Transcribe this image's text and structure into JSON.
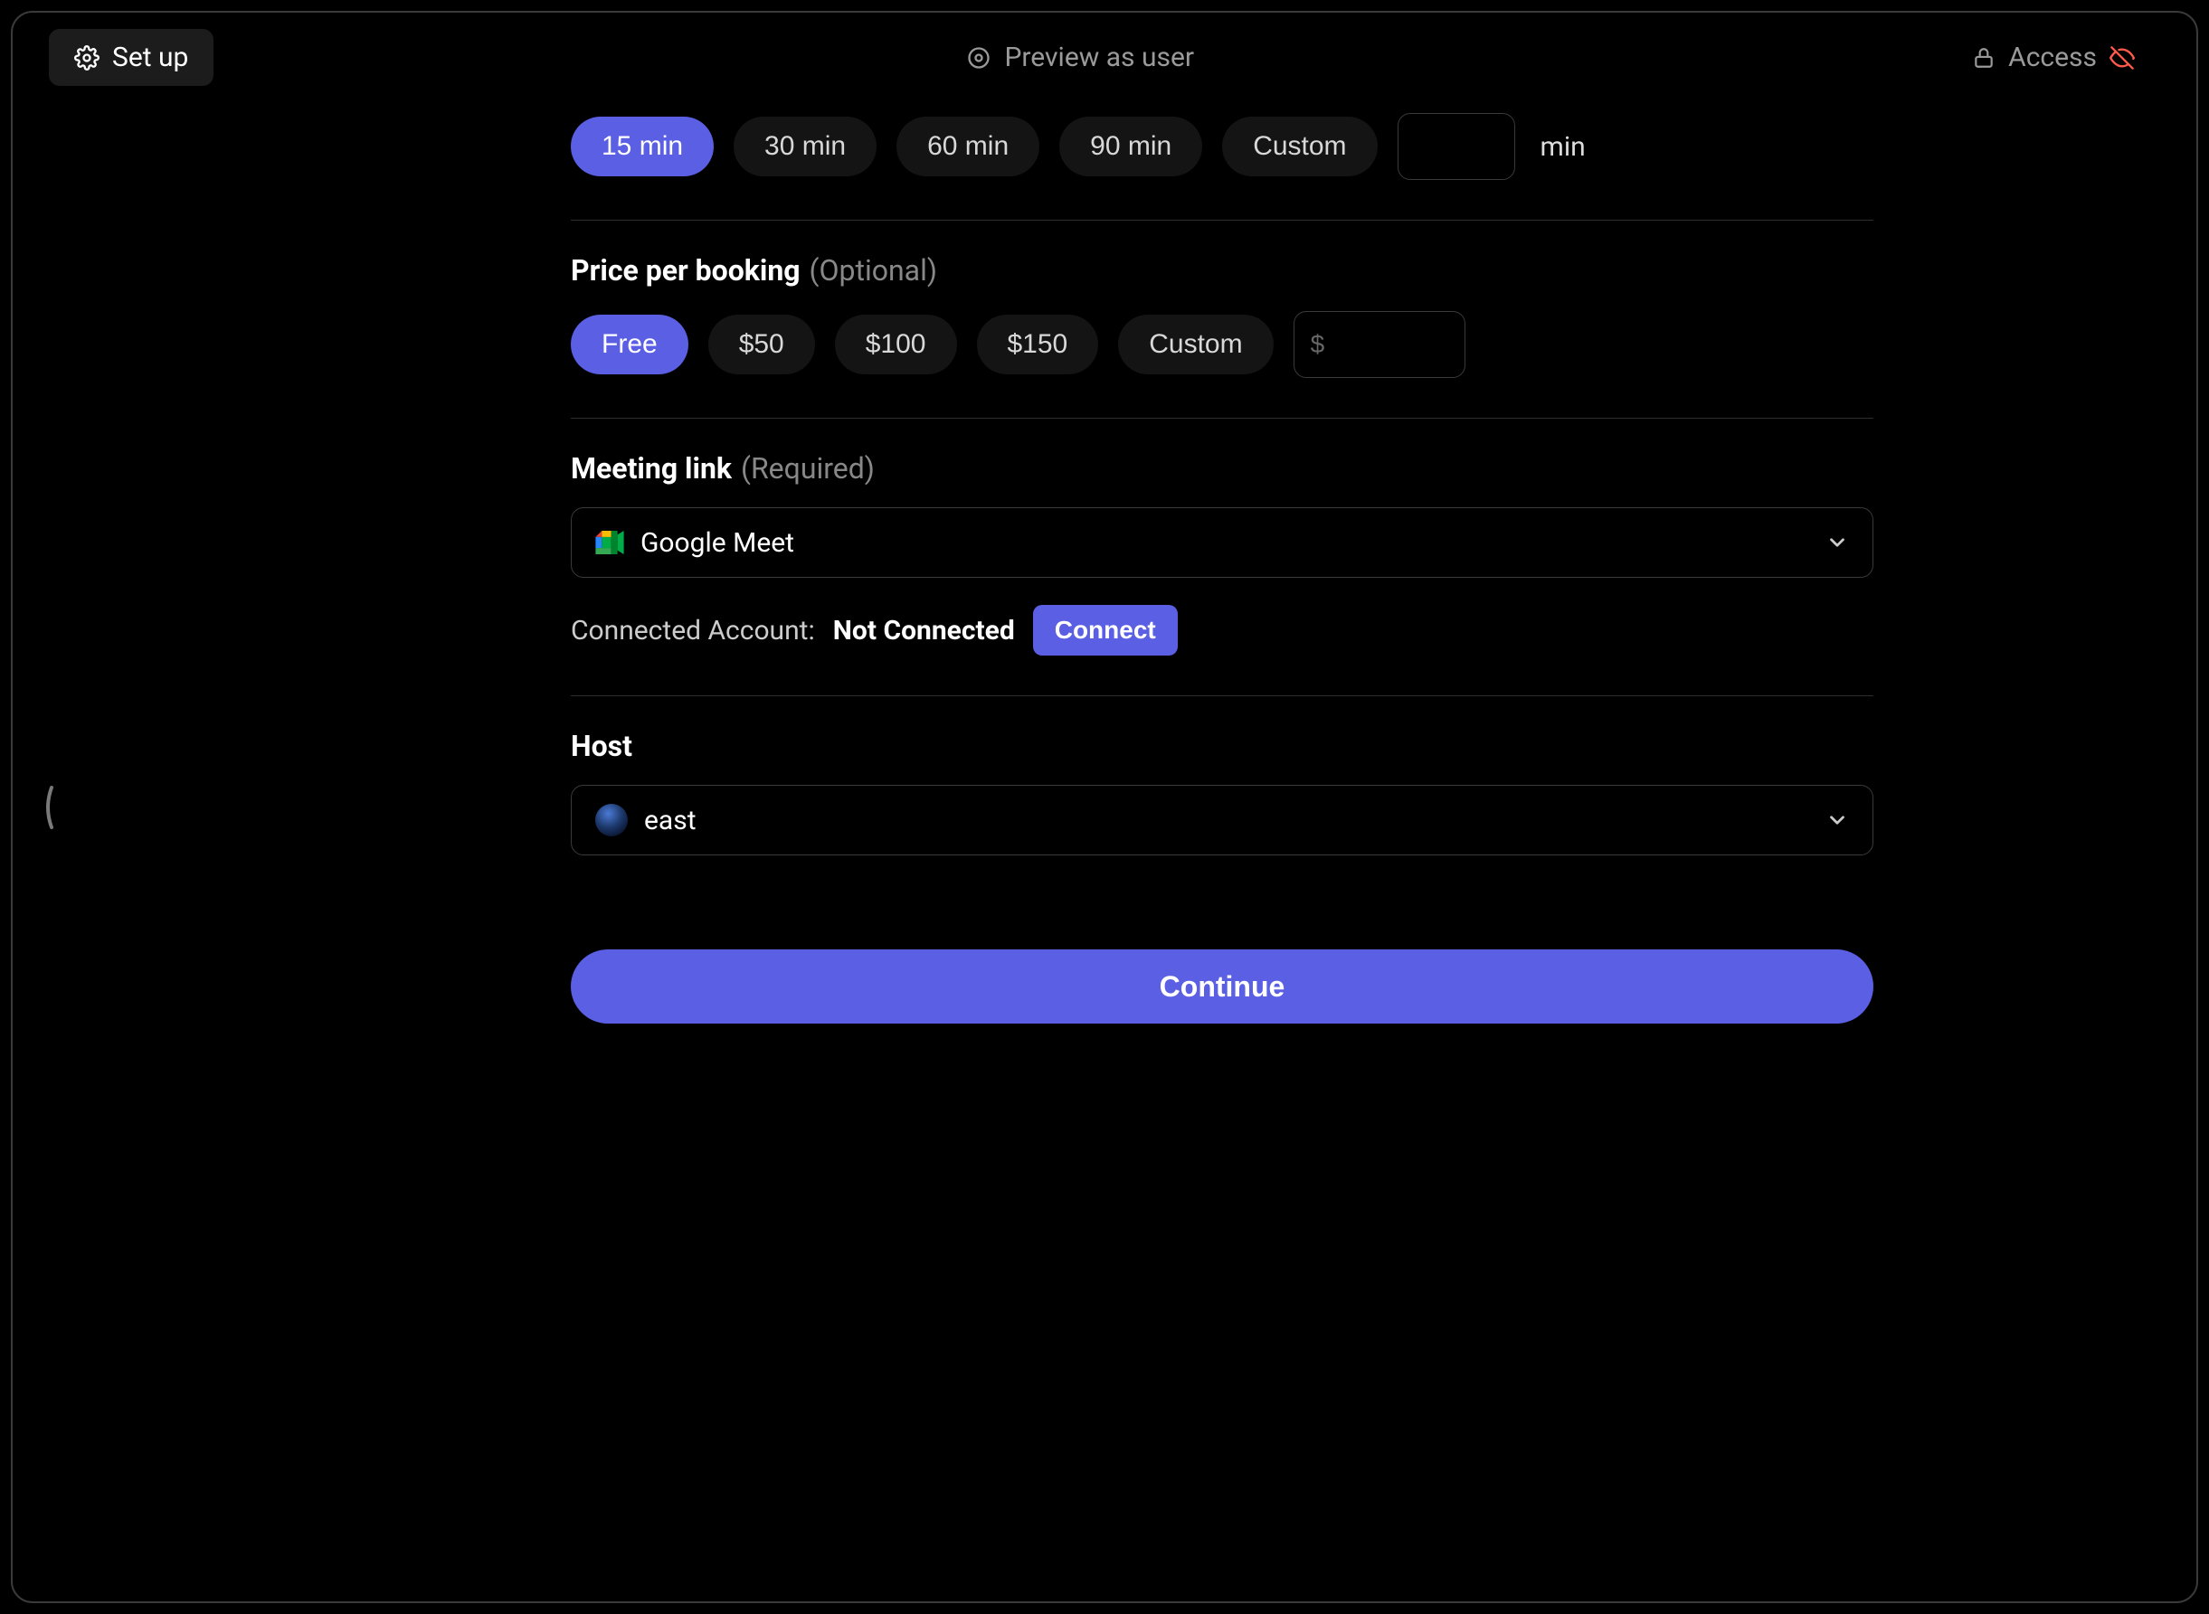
{
  "tabs": {
    "setup": "Set up",
    "preview": "Preview as user",
    "access": "Access"
  },
  "duration": {
    "options": [
      "15 min",
      "30 min",
      "60 min",
      "90 min",
      "Custom"
    ],
    "selected": "15 min",
    "custom_value": "",
    "suffix": "min"
  },
  "price": {
    "title": "Price per booking",
    "req": "(Optional)",
    "options": [
      "Free",
      "$50",
      "$100",
      "$150",
      "Custom"
    ],
    "selected": "Free",
    "custom_placeholder": "$",
    "custom_value": ""
  },
  "meeting": {
    "title": "Meeting link",
    "req": "(Required)",
    "provider": "Google Meet",
    "connected_label": "Connected Account:",
    "connected_status": "Not Connected",
    "connect_btn": "Connect"
  },
  "host": {
    "title": "Host",
    "value": "east"
  },
  "continue_btn": "Continue",
  "colors": {
    "accent": "#5b5fe3"
  }
}
